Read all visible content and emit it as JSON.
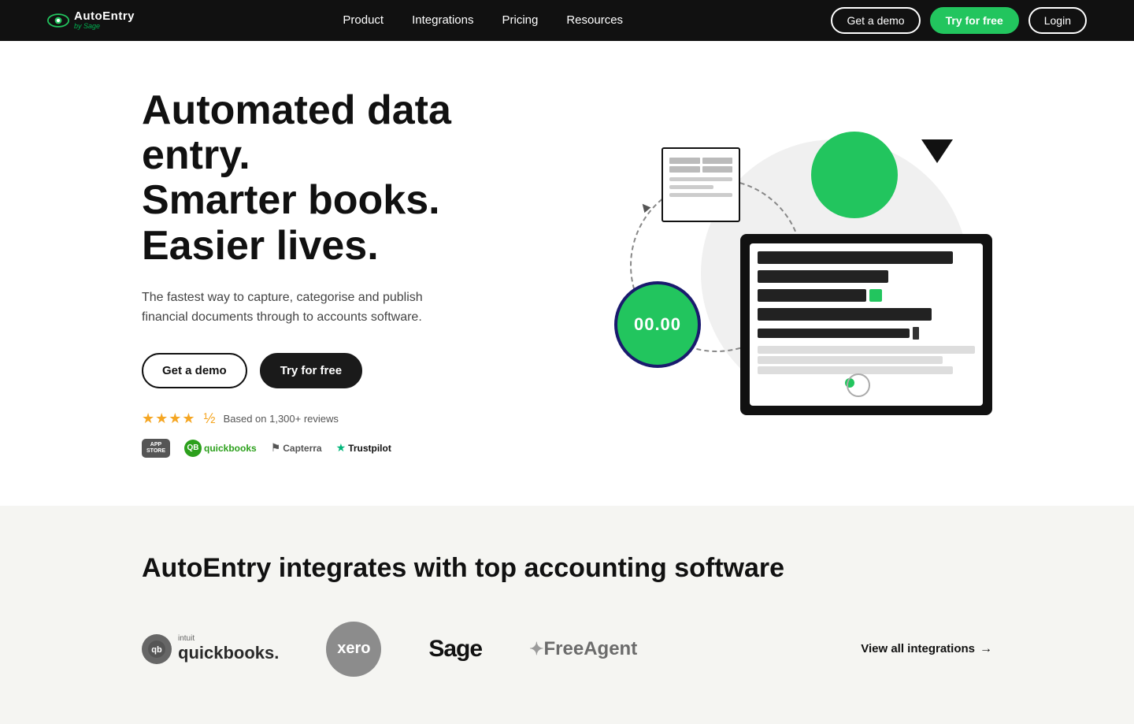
{
  "nav": {
    "logo": {
      "brand": "AutoEntry",
      "sub": "by Sage"
    },
    "links": [
      {
        "label": "Product",
        "href": "#"
      },
      {
        "label": "Integrations",
        "href": "#"
      },
      {
        "label": "Pricing",
        "href": "#"
      },
      {
        "label": "Resources",
        "href": "#"
      }
    ],
    "get_demo_label": "Get a demo",
    "try_free_label": "Try for free",
    "login_label": "Login"
  },
  "hero": {
    "heading_line1": "Automated data entry.",
    "heading_line2": "Smarter books.",
    "heading_line3": "Easier lives.",
    "subtext": "The fastest way to capture, categorise and publish financial documents through to accounts software.",
    "get_demo_label": "Get a demo",
    "try_free_label": "Try for free",
    "review_count": "Based on 1,300+ reviews",
    "price_display": "00.00",
    "partners": [
      "App Store",
      "QuickBooks",
      "Capterra",
      "Trustpilot"
    ]
  },
  "integrations": {
    "heading": "AutoEntry integrates with top accounting software",
    "logos": [
      {
        "name": "QuickBooks",
        "type": "quickbooks"
      },
      {
        "name": "Xero",
        "type": "xero"
      },
      {
        "name": "Sage",
        "type": "sage"
      },
      {
        "name": "FreeAgent",
        "type": "freeagent"
      }
    ],
    "view_all_label": "View all integrations",
    "view_all_arrow": "→"
  }
}
